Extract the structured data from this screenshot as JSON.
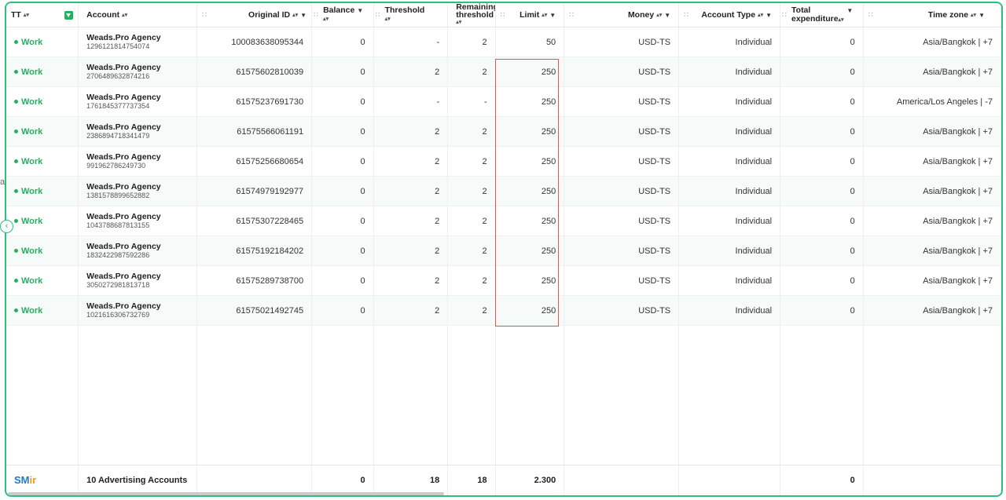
{
  "columns": {
    "tt": "TT",
    "account": "Account",
    "original_id": "Original ID",
    "balance": "Balance",
    "threshold": "Threshold",
    "remaining_threshold_1": "Remaining",
    "remaining_threshold_2": "threshold",
    "limit": "Limit",
    "money": "Money",
    "account_type": "Account Type",
    "total_expenditure_1": "Total",
    "total_expenditure_2": "expenditure",
    "time_zone": "Time zone"
  },
  "rows": [
    {
      "status": "Work",
      "name": "Weads.Pro Agency",
      "account_id": "1296121814754074",
      "original_id": "100083638095344",
      "balance": "0",
      "threshold": "-",
      "remaining": "2",
      "limit": "50",
      "money": "USD-TS",
      "type": "Individual",
      "total": "0",
      "timezone": "Asia/Bangkok | +7"
    },
    {
      "status": "Work",
      "name": "Weads.Pro Agency",
      "account_id": "2706489632874216",
      "original_id": "61575602810039",
      "balance": "0",
      "threshold": "2",
      "remaining": "2",
      "limit": "250",
      "money": "USD-TS",
      "type": "Individual",
      "total": "0",
      "timezone": "Asia/Bangkok | +7"
    },
    {
      "status": "Work",
      "name": "Weads.Pro Agency",
      "account_id": "1761845377737354",
      "original_id": "61575237691730",
      "balance": "0",
      "threshold": "-",
      "remaining": "-",
      "limit": "250",
      "money": "USD-TS",
      "type": "Individual",
      "total": "0",
      "timezone": "America/Los Angeles | -7"
    },
    {
      "status": "Work",
      "name": "Weads.Pro Agency",
      "account_id": "2386894718341479",
      "original_id": "61575566061191",
      "balance": "0",
      "threshold": "2",
      "remaining": "2",
      "limit": "250",
      "money": "USD-TS",
      "type": "Individual",
      "total": "0",
      "timezone": "Asia/Bangkok | +7"
    },
    {
      "status": "Work",
      "name": "Weads.Pro Agency",
      "account_id": "991962786249730",
      "original_id": "61575256680654",
      "balance": "0",
      "threshold": "2",
      "remaining": "2",
      "limit": "250",
      "money": "USD-TS",
      "type": "Individual",
      "total": "0",
      "timezone": "Asia/Bangkok | +7"
    },
    {
      "status": "Work",
      "name": "Weads.Pro Agency",
      "account_id": "1381578899652882",
      "original_id": "61574979192977",
      "balance": "0",
      "threshold": "2",
      "remaining": "2",
      "limit": "250",
      "money": "USD-TS",
      "type": "Individual",
      "total": "0",
      "timezone": "Asia/Bangkok | +7"
    },
    {
      "status": "Work",
      "name": "Weads.Pro Agency",
      "account_id": "1043788687813155",
      "original_id": "61575307228465",
      "balance": "0",
      "threshold": "2",
      "remaining": "2",
      "limit": "250",
      "money": "USD-TS",
      "type": "Individual",
      "total": "0",
      "timezone": "Asia/Bangkok | +7"
    },
    {
      "status": "Work",
      "name": "Weads.Pro Agency",
      "account_id": "1832422987592286",
      "original_id": "61575192184202",
      "balance": "0",
      "threshold": "2",
      "remaining": "2",
      "limit": "250",
      "money": "USD-TS",
      "type": "Individual",
      "total": "0",
      "timezone": "Asia/Bangkok | +7"
    },
    {
      "status": "Work",
      "name": "Weads.Pro Agency",
      "account_id": "3050272981813718",
      "original_id": "61575289738700",
      "balance": "0",
      "threshold": "2",
      "remaining": "2",
      "limit": "250",
      "money": "USD-TS",
      "type": "Individual",
      "total": "0",
      "timezone": "Asia/Bangkok | +7"
    },
    {
      "status": "Work",
      "name": "Weads.Pro Agency",
      "account_id": "1021616306732769",
      "original_id": "61575021492745",
      "balance": "0",
      "threshold": "2",
      "remaining": "2",
      "limit": "250",
      "money": "USD-TS",
      "type": "Individual",
      "total": "0",
      "timezone": "Asia/Bangkok | +7"
    }
  ],
  "footer": {
    "logo_a": "SM",
    "logo_b": "ir",
    "summary": "10 Advertising Accounts",
    "balance": "0",
    "threshold": "18",
    "remaining": "18",
    "limit": "2.300",
    "total": "0"
  },
  "edge_letter": "a",
  "icons": {
    "filter": "filter-icon",
    "sort": "sort-icon",
    "dropdown": "caret-down-icon",
    "collapse": "chevron-left-icon",
    "grip": "drag-handle-icon"
  },
  "colors": {
    "accent": "#2fbf7c",
    "status_work": "#27ae60",
    "highlight": "#e25555"
  }
}
